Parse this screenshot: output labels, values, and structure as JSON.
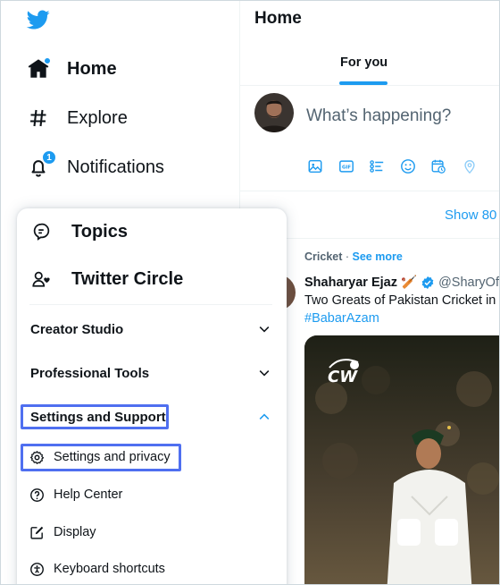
{
  "nav": {
    "home": "Home",
    "explore": "Explore",
    "notifications": "Notifications",
    "notifications_badge": "1"
  },
  "menu": {
    "topics": "Topics",
    "twitter_circle": "Twitter Circle",
    "creator_studio": "Creator Studio",
    "professional_tools": "Professional Tools",
    "settings_support": "Settings and Support",
    "settings_privacy": "Settings and privacy",
    "help_center": "Help Center",
    "display": "Display",
    "keyboard_shortcuts": "Keyboard shortcuts"
  },
  "main": {
    "title": "Home",
    "tab_for_you": "For you",
    "compose_placeholder": "What’s happening?",
    "show_more": "Show 80",
    "tweet": {
      "topic": "Cricket",
      "separator": " · ",
      "see_more": "See more",
      "author_name": "Shaharyar Ejaz 🏏",
      "handle": "@SharyOff",
      "text": "Two Greats of Pakistan Cricket in",
      "hashtag": "#BabarAzam"
    }
  },
  "icons": {
    "logo": "twitter-bird-icon",
    "home": "home-icon",
    "explore": "hashtag-icon",
    "notifications": "bell-icon",
    "topics": "topics-icon",
    "circle": "twitter-circle-icon",
    "settings": "gear-icon",
    "help": "help-icon",
    "display": "display-icon",
    "keyboard": "accessibility-icon"
  },
  "colors": {
    "accent": "#1d9bf0",
    "highlight": "#4f6ff0",
    "text": "#0f1419",
    "muted": "#536471"
  }
}
